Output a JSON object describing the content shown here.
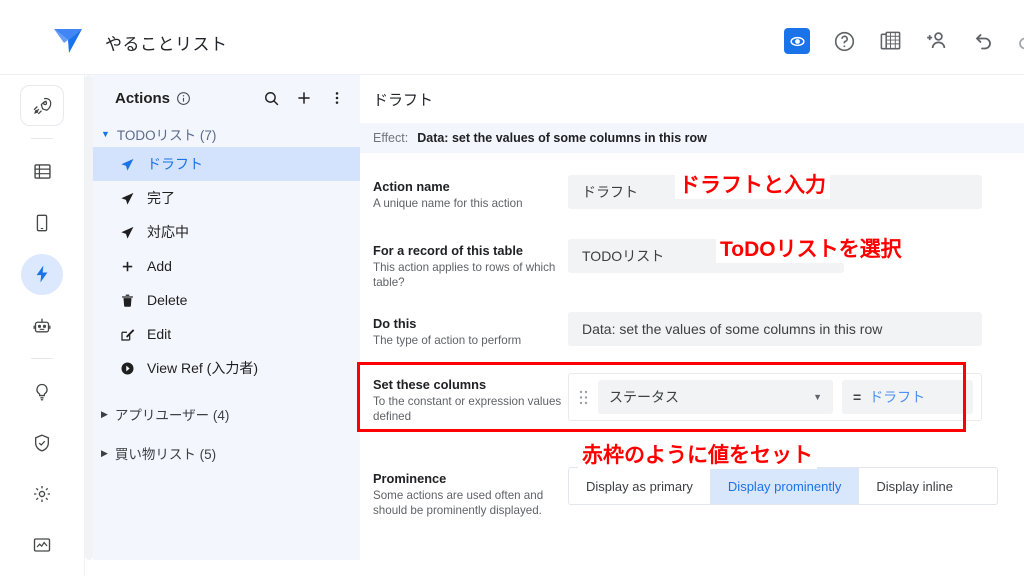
{
  "topbar": {
    "app_title": "やることリスト",
    "logo_name": "appsheet-logo",
    "icons": [
      {
        "name": "preview-eye-icon",
        "glyph": "eye",
        "active": true
      },
      {
        "name": "help-icon",
        "glyph": "help",
        "active": false
      },
      {
        "name": "tables-icon",
        "glyph": "tables",
        "active": false
      },
      {
        "name": "add-user-icon",
        "glyph": "add-user",
        "active": false
      },
      {
        "name": "undo-icon",
        "glyph": "undo",
        "active": false
      },
      {
        "name": "redo-icon",
        "glyph": "redo",
        "active": false
      }
    ]
  },
  "rail": {
    "items": [
      {
        "name": "rail-item-rocket",
        "glyph": "rocket",
        "style": "framed"
      },
      {
        "name": "rail-item-data",
        "glyph": "data",
        "style": "plain"
      },
      {
        "name": "rail-item-app",
        "glyph": "device",
        "style": "plain"
      },
      {
        "name": "rail-item-automation",
        "glyph": "bolt",
        "style": "active"
      },
      {
        "name": "rail-item-intelligence",
        "glyph": "robot",
        "style": "plain"
      },
      {
        "name": "rail-item-ideas",
        "glyph": "bulb",
        "style": "plain"
      },
      {
        "name": "rail-item-security",
        "glyph": "shield",
        "style": "plain"
      },
      {
        "name": "rail-item-settings",
        "glyph": "gear",
        "style": "plain"
      },
      {
        "name": "rail-item-monitor",
        "glyph": "monitor",
        "style": "plain"
      }
    ]
  },
  "sidebar": {
    "title": "Actions",
    "info_icon": "info-icon",
    "search_icon": "search-icon",
    "add_icon": "plus-icon",
    "more_icon": "more-vertical-icon",
    "groups": [
      {
        "label": "TODOリスト (7)",
        "expanded": true,
        "items": [
          {
            "label": "ドラフト",
            "icon": "send-icon",
            "selected": true
          },
          {
            "label": "完了",
            "icon": "send-icon",
            "selected": false
          },
          {
            "label": "対応中",
            "icon": "send-icon",
            "selected": false
          },
          {
            "label": "Add",
            "icon": "plus-icon",
            "selected": false
          },
          {
            "label": "Delete",
            "icon": "trash-icon",
            "selected": false
          },
          {
            "label": "Edit",
            "icon": "edit-icon",
            "selected": false
          },
          {
            "label": "View Ref (入力者)",
            "icon": "arrow-circle-icon",
            "selected": false
          }
        ]
      },
      {
        "label": "アプリユーザー (4)",
        "expanded": false,
        "items": []
      },
      {
        "label": "買い物リスト (5)",
        "expanded": false,
        "items": []
      }
    ]
  },
  "main": {
    "title": "ドラフト",
    "effect_label": "Effect:",
    "effect_value": "Data: set the values of some columns in this row",
    "rows": {
      "action_name": {
        "label": "Action name",
        "sub": "A unique name for this action",
        "value": "ドラフト"
      },
      "for_table": {
        "label": "For a record of this table",
        "sub": "This action applies to rows of which table?",
        "value": "TODOリスト"
      },
      "do_this": {
        "label": "Do this",
        "sub": "The type of action to perform",
        "value": "Data: set the values of some columns in this row"
      },
      "set_columns": {
        "label": "Set these columns",
        "sub": "To the constant or expression values defined",
        "drag_icon": "drag-handle-icon",
        "column": "ステータス",
        "caret_icon": "chevron-down-icon",
        "equals": "=",
        "value": "ドラフト"
      },
      "prominence": {
        "label": "Prominence",
        "sub": "Some actions are used often and should be prominently displayed.",
        "options": [
          {
            "label": "Display as primary",
            "selected": false
          },
          {
            "label": "Display prominently",
            "selected": true
          },
          {
            "label": "Display inline",
            "selected": false
          }
        ]
      }
    }
  },
  "annotations": {
    "action_name_note": "ドラフトと入力",
    "table_note": "ToDOリストを選択",
    "set_columns_note": "赤枠のように値をセット"
  },
  "colors": {
    "accent_blue": "#1a73e8",
    "selected_row": "#d3e3fd",
    "sidebar_bg": "#f3f6fc",
    "field_bg": "#f1f3f4",
    "annotation_red": "#ff0000"
  }
}
